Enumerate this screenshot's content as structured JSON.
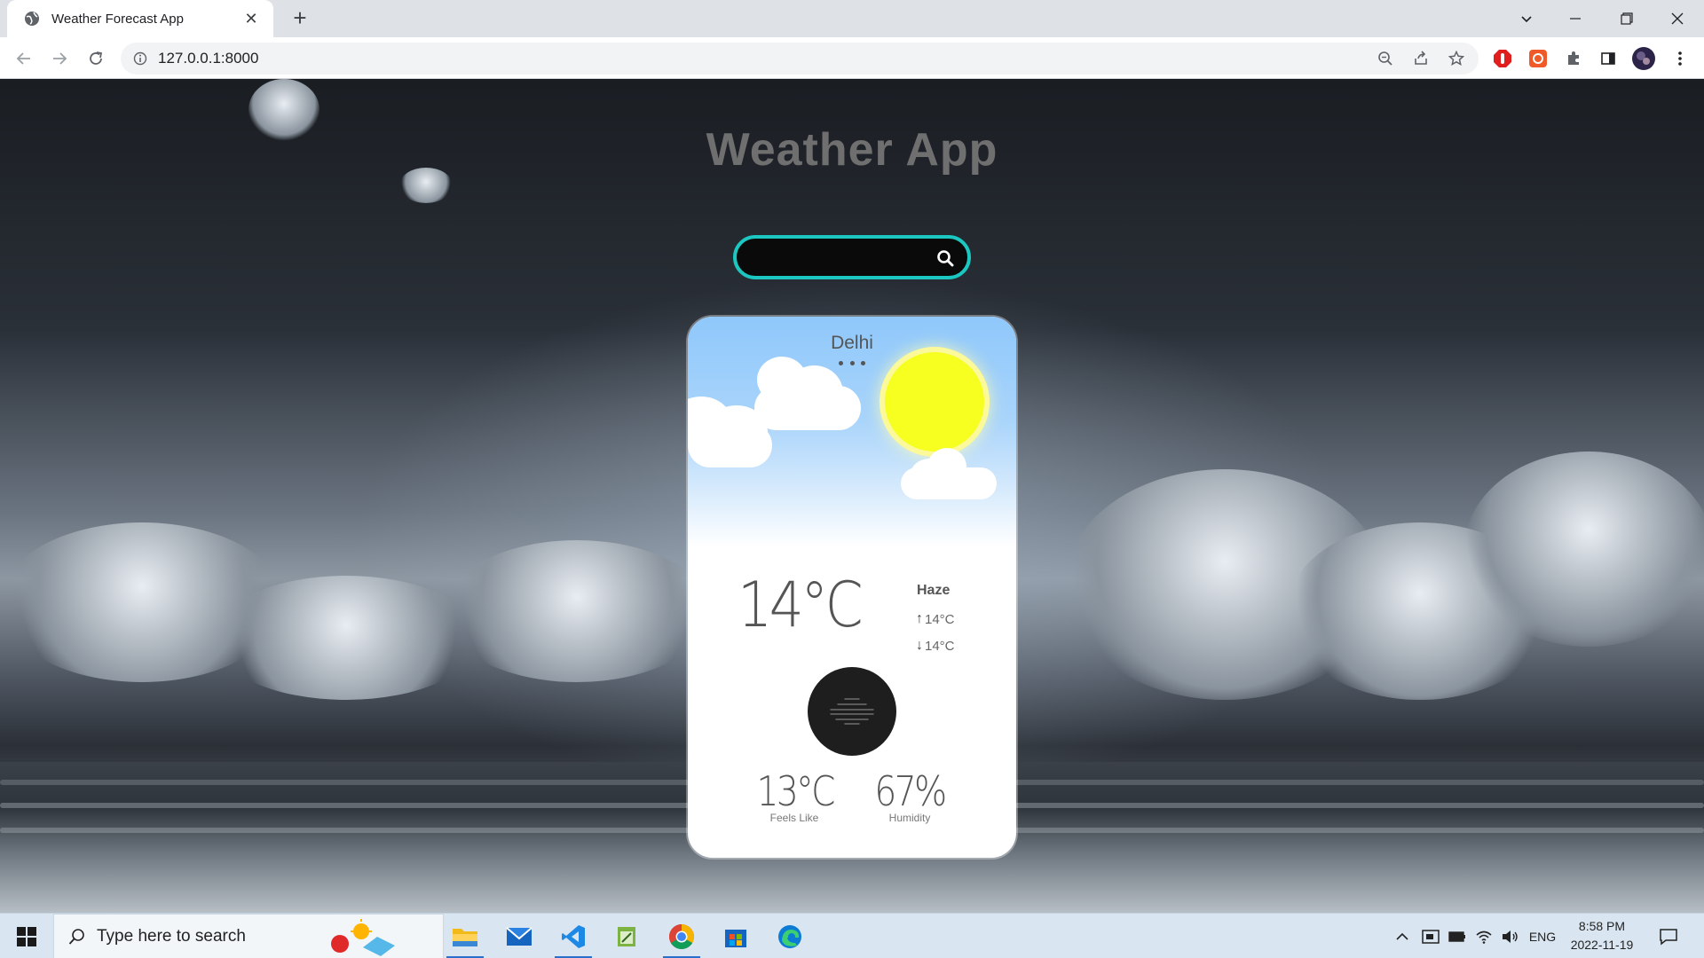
{
  "browser": {
    "tab_title": "Weather Forecast App",
    "new_tab_label": "+",
    "url": "127.0.0.1:8000"
  },
  "page": {
    "app_title": "Weather App",
    "search": {
      "value": "",
      "placeholder": ""
    },
    "card": {
      "city": "Delhi",
      "temperature": "14°C",
      "condition": "Haze",
      "temp_max": "14°C",
      "temp_min": "14°C",
      "feels_like_value": "13°C",
      "feels_like_label": "Feels Like",
      "humidity_value": "67%",
      "humidity_label": "Humidity",
      "weather_icon": "haze-icon"
    }
  },
  "taskbar": {
    "search_placeholder": "Type here to search",
    "language": "ENG",
    "time": "8:58 PM",
    "date": "2022-11-19",
    "apps": [
      "file-explorer",
      "mail",
      "vscode",
      "notepad-app",
      "chrome",
      "store",
      "edge"
    ]
  },
  "colors": {
    "search_border": "#1bc7c0",
    "sun": "#f6ff1f",
    "sky_top": "#8fc8fb",
    "weather_icon_bg": "#1e1e1e"
  }
}
